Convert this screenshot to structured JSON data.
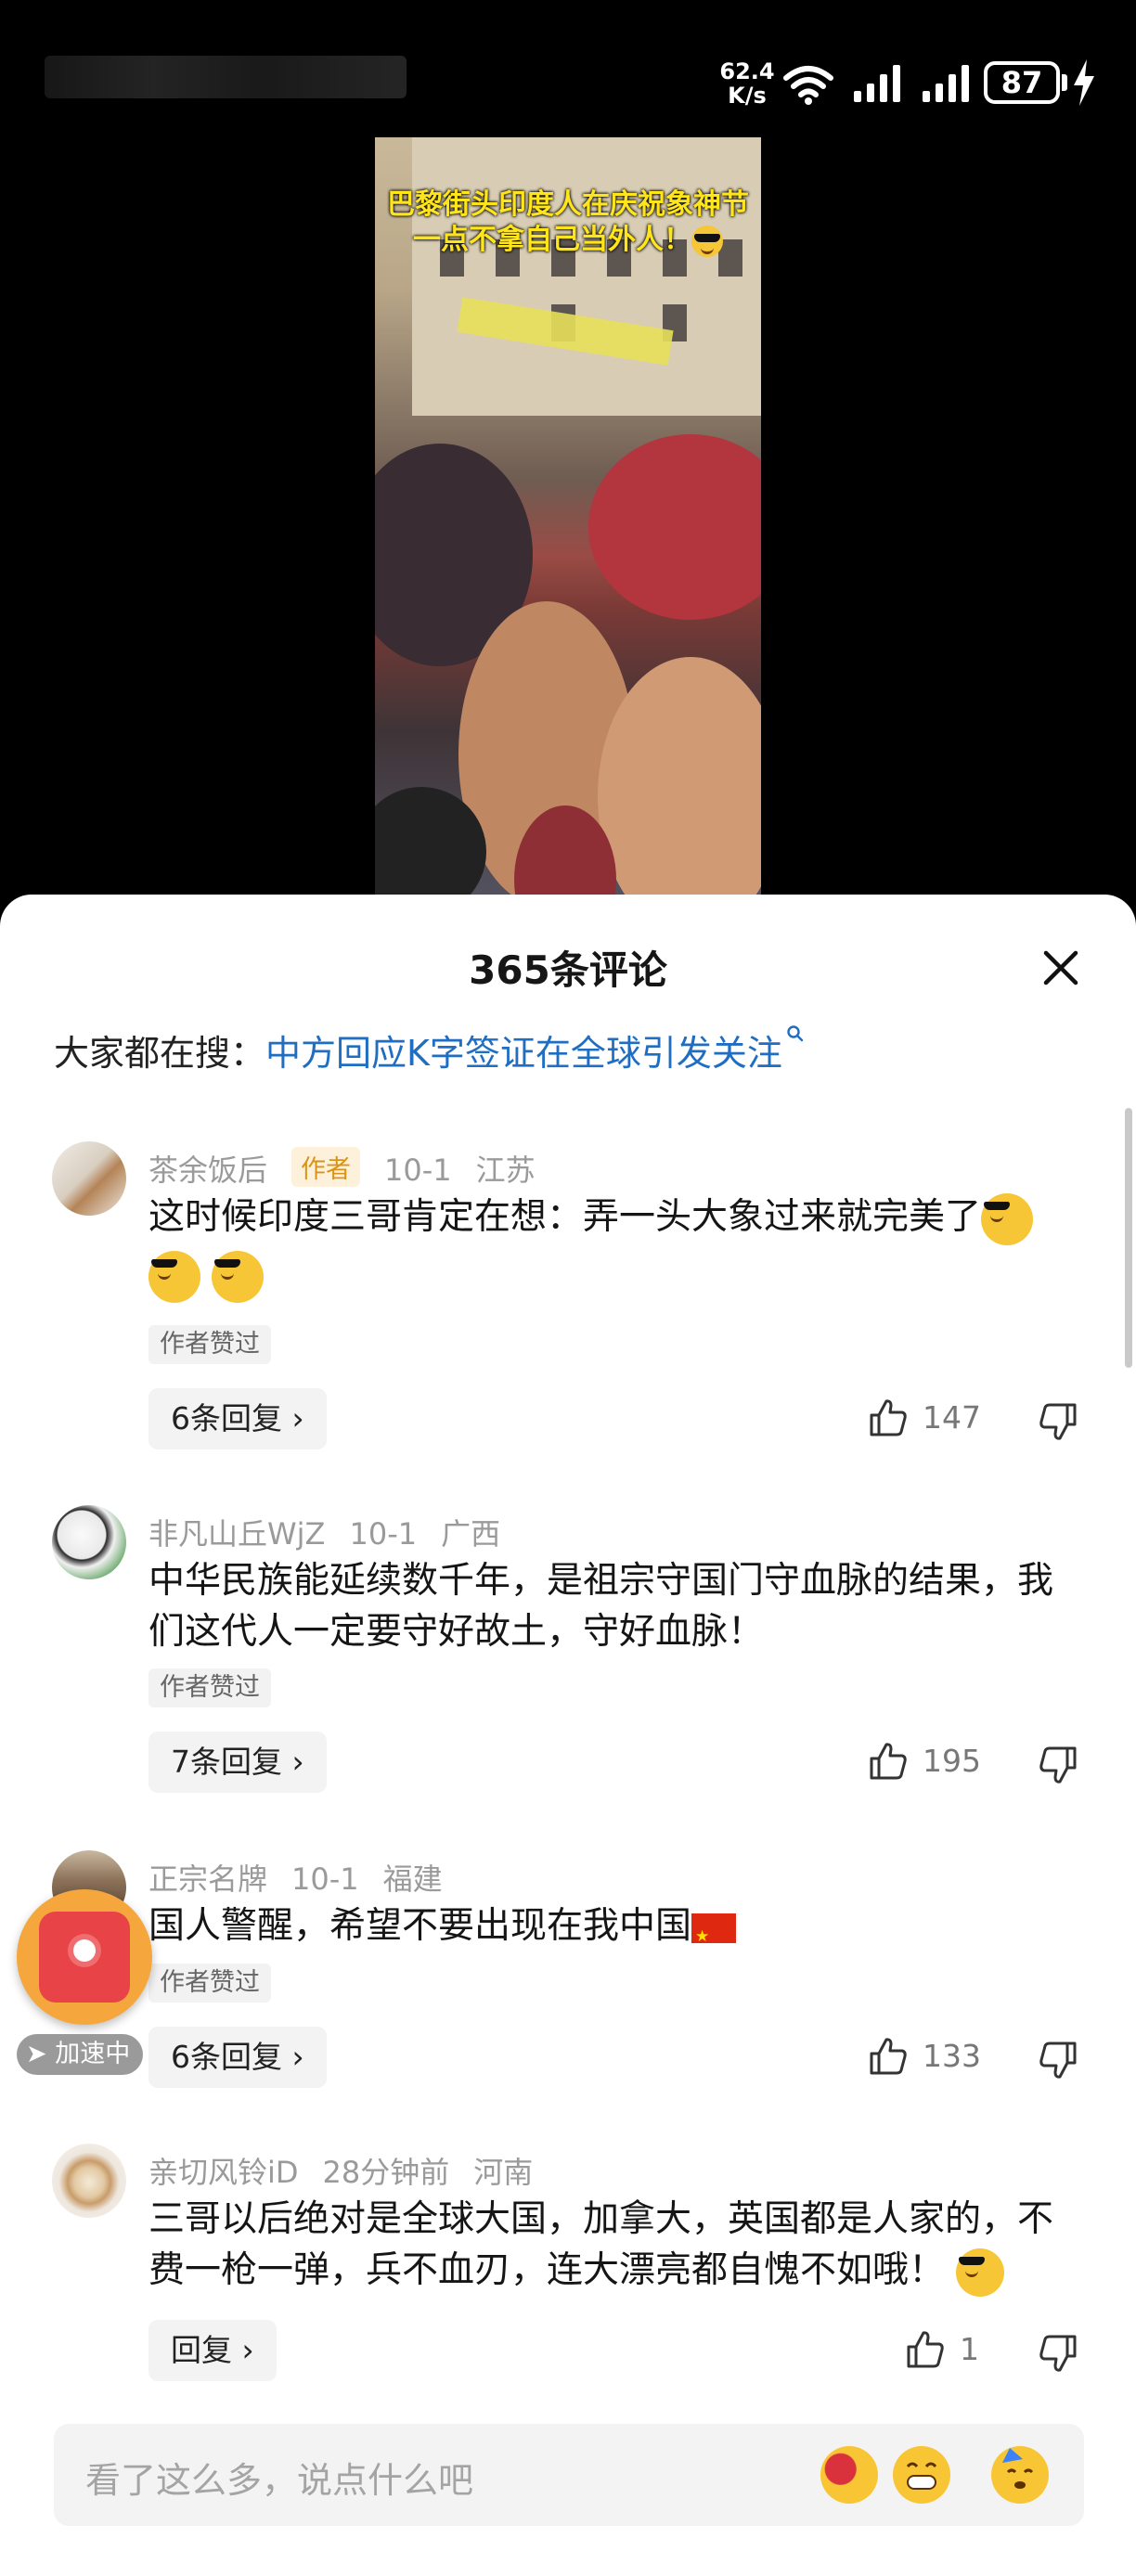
{
  "status_bar": {
    "net_speed_value": "62.4",
    "net_speed_unit": "K/s",
    "battery": "87",
    "icons": [
      "wifi-icon",
      "signal-icon",
      "signal-icon",
      "battery-icon",
      "charging-bolt-icon"
    ]
  },
  "video": {
    "caption_line1": "巴黎街头印度人在庆祝象神节",
    "caption_line2": "一点不拿自己当外人！"
  },
  "sheet": {
    "title": "365条评论",
    "trending_label": "大家都在搜：",
    "trending_query": "中方回应K字签证在全球引发关注"
  },
  "comments": [
    {
      "user": "茶余饭后",
      "author_tag": "作者",
      "date": "10-1",
      "location": "江苏",
      "text": "这时候印度三哥肯定在想：弄一头大象过来就完美了",
      "liked_by_author": "作者赞过",
      "replies": "6条回复",
      "likes": "147"
    },
    {
      "user": "非凡山丘WjZ",
      "date": "10-1",
      "location": "广西",
      "text": "中华民族能延续数千年，是祖宗守国门守血脉的结果，我们这代人一定要守好故土，守好血脉！",
      "liked_by_author": "作者赞过",
      "replies": "7条回复",
      "likes": "195"
    },
    {
      "user": "正宗名牌",
      "date": "10-1",
      "location": "福建",
      "text": "国人警醒，希望不要出现在我中国",
      "liked_by_author": "作者赞过",
      "replies": "6条回复",
      "likes": "133"
    },
    {
      "user": "亲切风铃iD",
      "date": "28分钟前",
      "location": "河南",
      "text": "三哥以后绝对是全球大国，加拿大，英国都是人家的，不费一枪一弹，兵不血刃，连大漂亮都自愧不如哦！",
      "replies": "回复",
      "likes": "1"
    }
  ],
  "floating": {
    "boost_label": "加速中"
  },
  "input": {
    "placeholder": "看了这么多，说点什么吧"
  },
  "colors": {
    "link": "#1f6ec2",
    "author_tag_bg": "#fdf1db",
    "author_tag_text": "#d99418",
    "badge_orange": "#f5a73d",
    "badge_red": "#e84346"
  }
}
